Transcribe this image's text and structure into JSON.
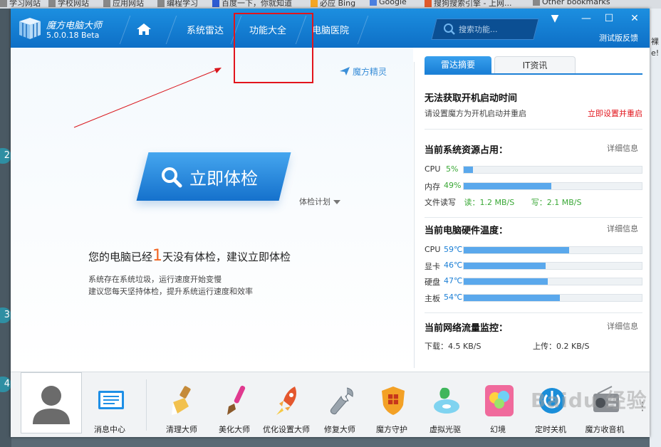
{
  "bookmarks": [
    {
      "label": "学习网站",
      "icon": "folder-icon"
    },
    {
      "label": "学校网站",
      "icon": "folder-icon"
    },
    {
      "label": "应用网站",
      "icon": "folder-icon"
    },
    {
      "label": "编程学习",
      "icon": "folder-icon"
    },
    {
      "label": "百度一下，你就知道",
      "icon": "baidu-icon"
    },
    {
      "label": "必应 Bing",
      "icon": "bing-icon"
    },
    {
      "label": "Google",
      "icon": "google-icon"
    },
    {
      "label": "搜狗搜索引擎 - 上网...",
      "icon": "sogou-icon"
    },
    {
      "label": "Other bookmarks",
      "icon": "folder-icon"
    }
  ],
  "side_numbers": [
    "2",
    "3",
    "4"
  ],
  "side_right_fragments": [
    "裸",
    "e!"
  ],
  "app": {
    "name": "魔方电脑大师",
    "version": "5.0.0.18 Beta",
    "nav_tabs": [
      "系统雷达",
      "功能大全",
      "电脑医院"
    ],
    "search_placeholder": "搜索功能...",
    "feedback": "测试版反馈",
    "win_controls": [
      "▼",
      "—",
      "☐",
      "✕"
    ]
  },
  "main": {
    "spirit_label": "魔方精灵",
    "check_button": "立即体检",
    "plan_label": "体检计划",
    "days_prefix": "您的电脑已经",
    "days_num": "1",
    "days_suffix": "天没有体检，建议立即体检",
    "tip1": "系统存在系统垃圾，运行速度开始变慢",
    "tip2": "建议您每天坚持体检，提升系统运行速度和效率"
  },
  "right": {
    "tabs": [
      "雷达摘要",
      "IT资讯"
    ],
    "boot_title": "无法获取开机启动时间",
    "boot_sub": "请设置魔方为开机启动并重启",
    "boot_link": "立即设置并重启",
    "res_title": "当前系统资源占用：",
    "detail": "详细信息",
    "resources": [
      {
        "label": "CPU",
        "value": "5%",
        "fill": 0.05
      },
      {
        "label": "内存",
        "value": "49%",
        "fill": 0.49
      }
    ],
    "disk_label": "文件读写",
    "disk_read": "读：1.2 MB/S",
    "disk_write": "写：2.1 MB/S",
    "temp_title": "当前电脑硬件温度：",
    "temps": [
      {
        "label": "CPU",
        "value": "59℃",
        "fill": 0.59
      },
      {
        "label": "显卡",
        "value": "46℃",
        "fill": 0.46
      },
      {
        "label": "硬盘",
        "value": "47℃",
        "fill": 0.47
      },
      {
        "label": "主板",
        "value": "54℃",
        "fill": 0.54
      }
    ],
    "net_title": "当前网络流量监控：",
    "download": "下载：4.5 KB/S",
    "upload": "上传：0.2 KB/S"
  },
  "tools": [
    {
      "label": "消息中心",
      "icon": "message-center-icon"
    },
    {
      "label": "清理大师",
      "icon": "cleaning-brush-icon"
    },
    {
      "label": "美化大师",
      "icon": "paint-brush-icon"
    },
    {
      "label": "优化设置大师",
      "icon": "rocket-icon"
    },
    {
      "label": "修复大师",
      "icon": "wrench-icon"
    },
    {
      "label": "魔方守护",
      "icon": "shield-icon"
    },
    {
      "label": "虚拟光驱",
      "icon": "virtual-disc-icon"
    },
    {
      "label": "幻境",
      "icon": "balloons-icon"
    },
    {
      "label": "定时关机",
      "icon": "power-icon"
    },
    {
      "label": "魔方收音机",
      "icon": "radio-icon"
    }
  ],
  "watermark": "Baidu 经验",
  "colors": {
    "titlebar": "#1279d4",
    "accent": "#1d80d6",
    "warn": "#e2151c",
    "good": "#3aa836",
    "highlight": "#f26522"
  }
}
